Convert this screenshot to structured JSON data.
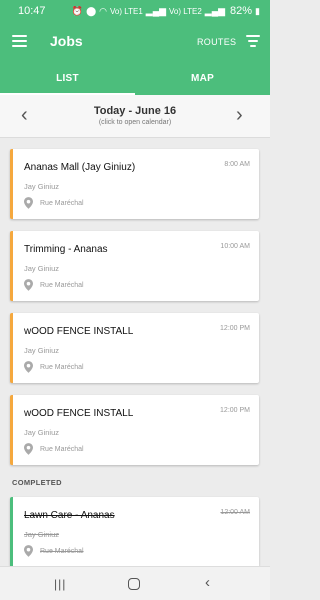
{
  "status": {
    "time": "10:47",
    "icons": [
      "alarm-icon",
      "location-icon",
      "wifi-icon",
      "signal-icon",
      "signal-icon"
    ],
    "network1": "Vo) LTE1",
    "network2": "Vo) LTE2",
    "battery": "82%"
  },
  "header": {
    "title": "Jobs",
    "routes_label": "ROUTES"
  },
  "tabs": [
    {
      "label": "LIST",
      "active": true
    },
    {
      "label": "MAP",
      "active": false
    }
  ],
  "date_bar": {
    "title": "Today - June 16",
    "hint": "(click to open calendar)"
  },
  "jobs": [
    {
      "title": "Ananas Mall (Jay Giniuz)",
      "time": "8:00 AM",
      "assignee": "Jay Giniuz",
      "location": "Rue Maréchal"
    },
    {
      "title": "Trimming - Ananas",
      "time": "10:00 AM",
      "assignee": "Jay Giniuz",
      "location": "Rue Maréchal"
    },
    {
      "title": "wOOD FENCE INSTALL",
      "time": "12:00 PM",
      "assignee": "Jay Giniuz",
      "location": "Rue Maréchal"
    },
    {
      "title": "wOOD FENCE INSTALL",
      "time": "12:00 PM",
      "assignee": "Jay Giniuz",
      "location": "Rue Maréchal"
    }
  ],
  "completed_section": {
    "label": "COMPLETED",
    "jobs": [
      {
        "title": "Lawn Care - Ananas",
        "time": "12:00 AM",
        "assignee": "Jay Giniuz",
        "location": "Rue Maréchal"
      }
    ]
  },
  "colors": {
    "primary": "#4cbe7c",
    "pending_accent": "#f5a83e",
    "completed_accent": "#4cbe7c"
  },
  "nav": {
    "recents_glyph": "|||",
    "back_glyph": "‹"
  }
}
